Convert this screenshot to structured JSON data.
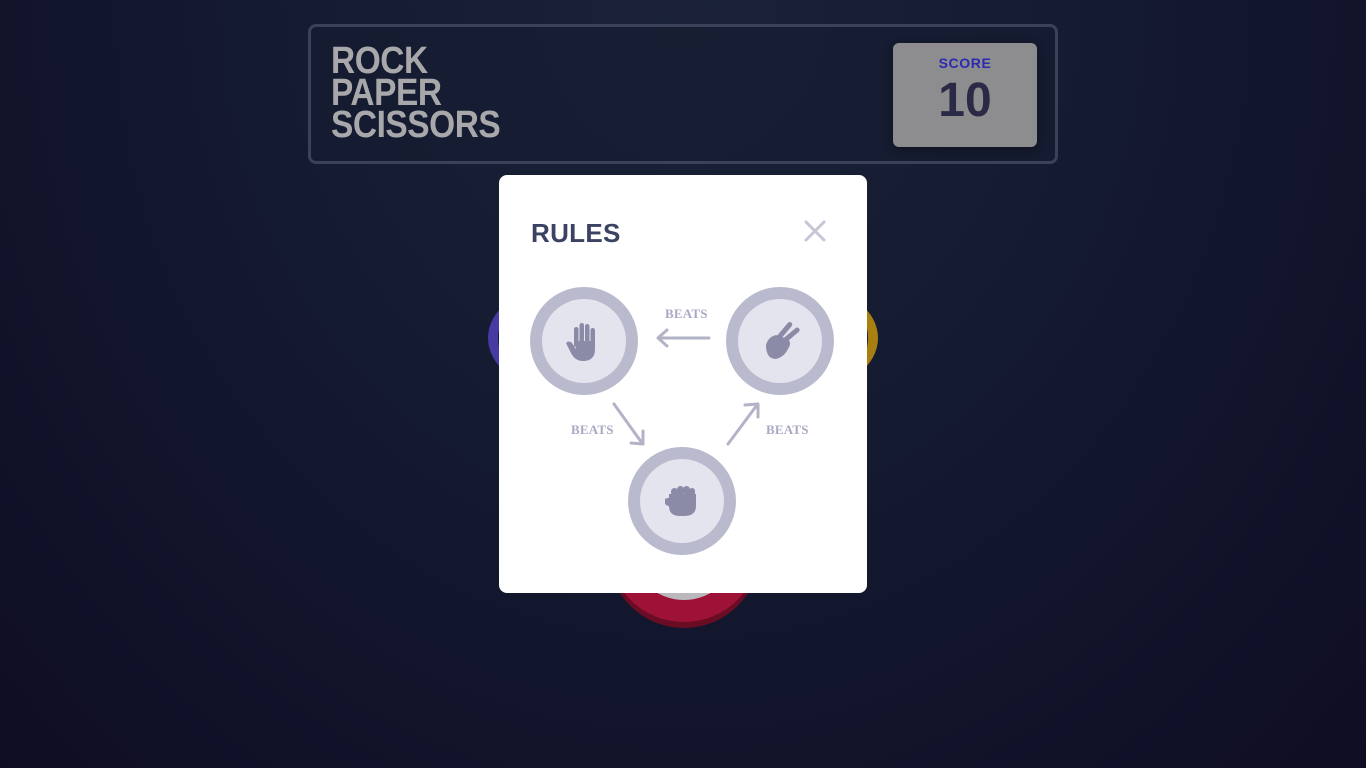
{
  "header": {
    "title_lines": [
      "ROCK",
      "PAPER",
      "SCISSORS"
    ],
    "score_label": "SCORE",
    "score_value": "10"
  },
  "rules_modal": {
    "title": "RULES",
    "close_icon": "close-icon",
    "beats_labels": [
      "BEATS",
      "BEATS",
      "BEATS"
    ],
    "tokens": [
      "paper",
      "scissors",
      "rock"
    ]
  },
  "colors": {
    "background": "#141a30",
    "header_border": "#3a4259",
    "title_text": "#a8a8aa",
    "score_box": "#8d8d8f",
    "score_label": "#2c2ab0",
    "score_value": "#2a2a46",
    "modal_bg": "#ffffff",
    "modal_title": "#3b4262",
    "rule_token": "#babace",
    "rule_icon": "#8b8ba8",
    "rock_bg": "#9e1237",
    "paper_bg": "#4c3fb0",
    "scissors_bg": "#b98a0e"
  }
}
